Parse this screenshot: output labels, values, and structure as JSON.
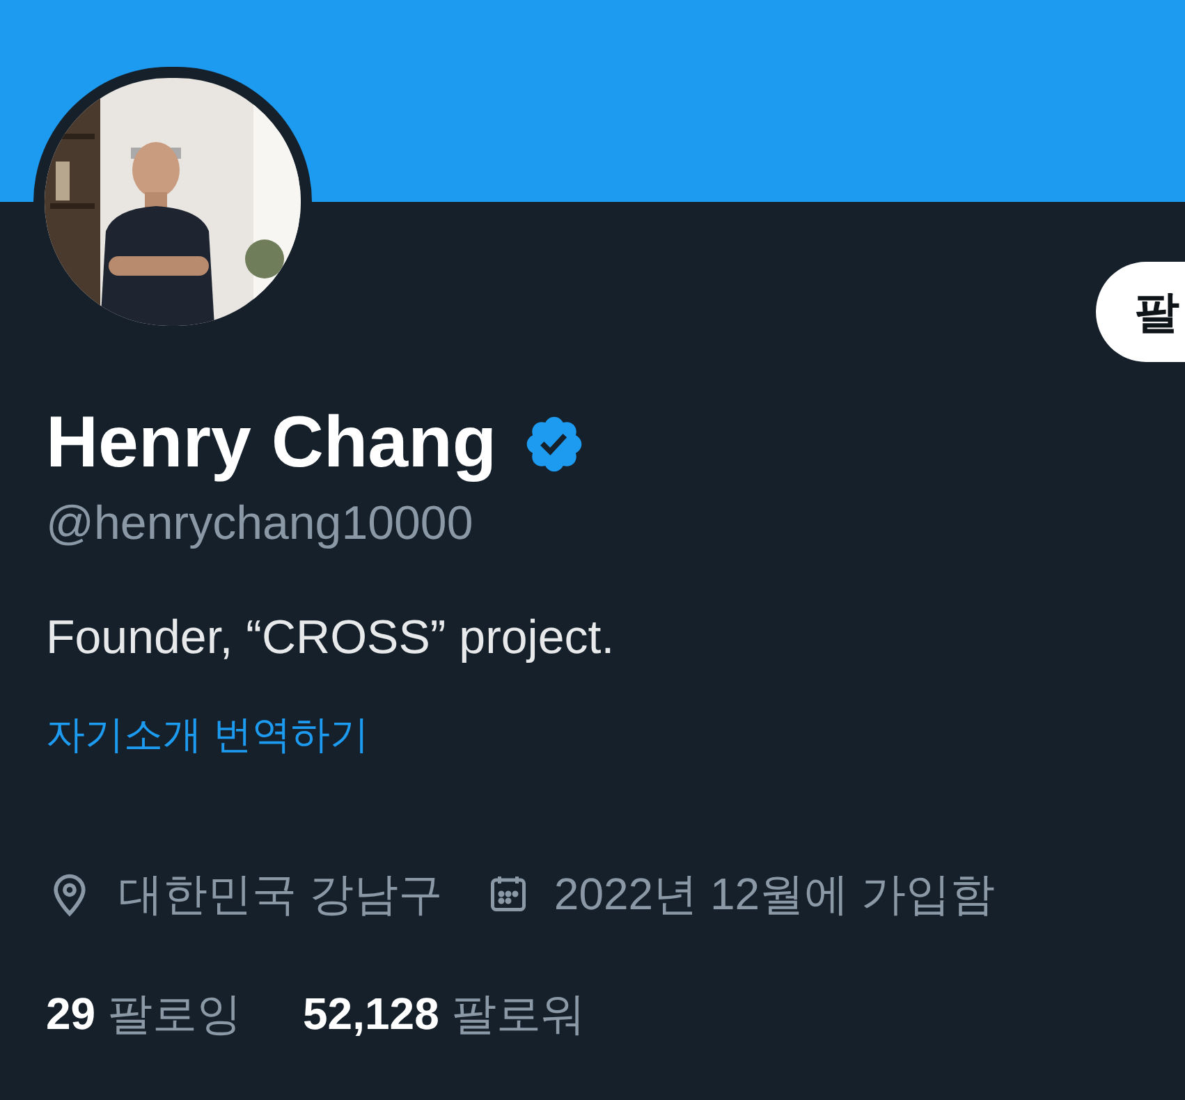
{
  "profile": {
    "follow_button": {
      "label": "팔"
    },
    "name": "Henry Chang",
    "verified": true,
    "handle": "@henrychang10000",
    "bio": "Founder, “CROSS” project.",
    "translate_link": "자기소개 번역하기",
    "location": "대한민국 강남구",
    "joined": "2022년 12월에 가입함",
    "stats": [
      {
        "count": "29",
        "label": "팔로잉"
      },
      {
        "count": "52,128",
        "label": "팔로워"
      }
    ]
  }
}
